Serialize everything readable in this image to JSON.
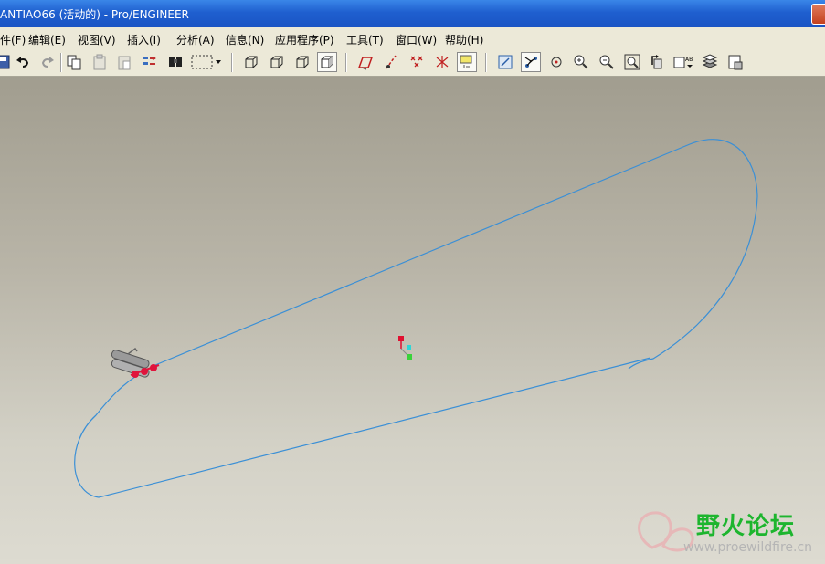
{
  "window": {
    "title": "ANTIAO66 (活动的) - Pro/ENGINEER"
  },
  "menu": {
    "items": [
      {
        "label": "件(F)"
      },
      {
        "label": "编辑(E)"
      },
      {
        "label": "视图(V)"
      },
      {
        "label": "插入(I)"
      },
      {
        "label": "分析(A)"
      },
      {
        "label": "信息(N)"
      },
      {
        "label": "应用程序(P)"
      },
      {
        "label": "工具(T)"
      },
      {
        "label": "窗口(W)"
      },
      {
        "label": "帮助(H)"
      }
    ]
  },
  "toolbar": {
    "buttons": [
      "save-icon",
      "undo-icon",
      "redo-icon",
      "copy-icon",
      "paste-icon",
      "paste-special-icon",
      "regenerate-icon",
      "find-icon",
      "select-box-icon",
      "wireframe-icon",
      "hidden-line-icon",
      "no-hidden-icon",
      "shading-icon",
      "datum-plane-icon",
      "datum-axis-icon",
      "datum-point-icon",
      "coordinate-system-icon",
      "annotation-icon",
      "refit-icon",
      "spin-center-icon",
      "orient-mode-icon",
      "zoom-in-icon",
      "zoom-out-icon",
      "zoom-fit-icon",
      "reorient-icon",
      "saved-views-icon",
      "layers-icon",
      "model-tree-icon"
    ],
    "pressed": [
      "shading-icon",
      "annotation-icon",
      "spin-center-icon"
    ]
  },
  "watermark": {
    "text_cn": "野火论坛",
    "url": "www.proewildfire.cn"
  },
  "colors": {
    "curve": "#3a8fd6",
    "part_red": "#e0143c",
    "datum_red": "#e01030",
    "datum_cyan": "#2fd6d6",
    "datum_green": "#3ad23a",
    "watermark_green": "#1db52e"
  }
}
